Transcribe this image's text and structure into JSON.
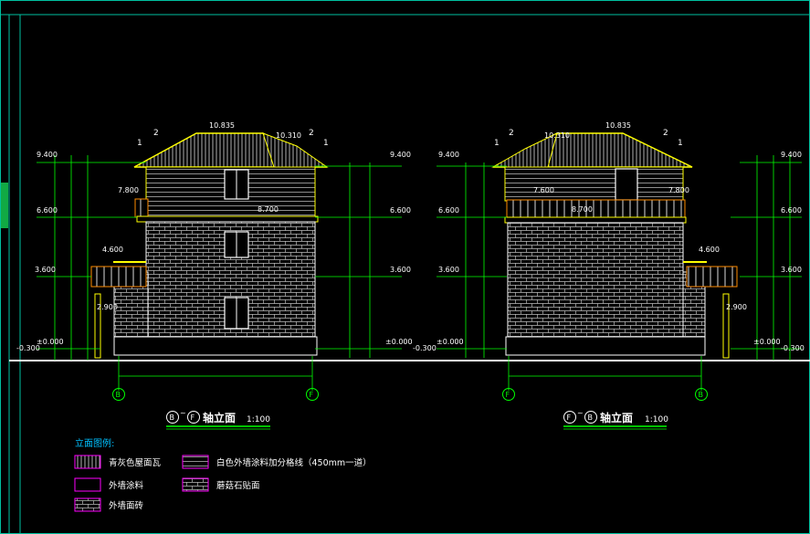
{
  "left_view": {
    "title_ax1": "B",
    "title_tilde": "~",
    "title_ax2": "F",
    "title_text": "轴立面",
    "scale": "1:100",
    "ridge_level": "10.835",
    "eave_level": "10.310",
    "callout_num_a": "2",
    "callout_num_b": "1",
    "levels": {
      "top": "9.400",
      "upper": "6.600",
      "mid": "3.600",
      "ground": "±0.000",
      "out": "-0.300"
    },
    "inner": {
      "balcony": "7.800",
      "roof2": "8.700",
      "canopy": "4.600",
      "wall": "2.900"
    },
    "axis_start": "B",
    "axis_end": "F"
  },
  "right_view": {
    "title_ax1": "F",
    "title_tilde": "~",
    "title_ax2": "B",
    "title_text": "轴立面",
    "scale": "1:100",
    "ridge_level": "10.835",
    "eave_level": "10.310",
    "callout_num_a": "2",
    "callout_num_b": "1",
    "levels": {
      "top": "9.400",
      "upper": "6.600",
      "mid": "3.600",
      "ground": "±0.000",
      "out": "-0.300"
    },
    "inner": {
      "balcony_l": "7.600",
      "balcony_r": "7.800",
      "roof2": "8.700",
      "canopy": "4.600",
      "wall": "2.900"
    },
    "axis_start": "F",
    "axis_end": "B"
  },
  "legend": {
    "title": "立面图例:",
    "items": [
      {
        "label": "青灰色屋面瓦"
      },
      {
        "label": "白色外墙涂料加分格线（450mm一道）"
      },
      {
        "label": "外墙涂料"
      },
      {
        "label": "蘑菇石贴面"
      },
      {
        "label": "外墙面砖"
      }
    ]
  },
  "colors": {
    "line": "#ffff00",
    "dim": "#00ff00",
    "legend": "#ff00ff",
    "axis": "#00ff00",
    "wall": "#ffffff",
    "frame": "#00c0a0"
  }
}
